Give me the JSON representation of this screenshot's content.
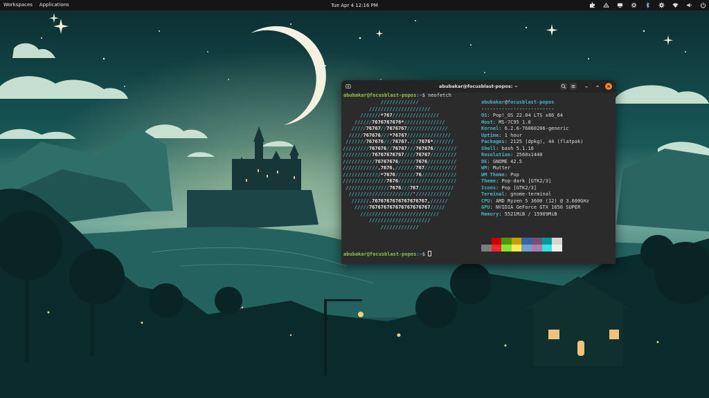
{
  "topbar": {
    "workspaces": "Workspaces",
    "applications": "Applications",
    "clock": "Tue Apr 4  12:16 PM",
    "tray": [
      "extension-icon",
      "network-icon",
      "screen-share-icon",
      "settings-indicator-icon",
      "bluetooth-icon",
      "gear-icon",
      "wifi-icon",
      "volume-icon",
      "power-icon"
    ]
  },
  "terminal": {
    "title": "abubakar@focusblast-popos: ~",
    "prompt_user": "abubakar@focusblast-popos",
    "prompt_path": ":~",
    "prompt_symbol": "$ ",
    "command": "neofetch",
    "header_user": "abubakar",
    "header_at": "@",
    "header_host": "focusblast-popos",
    "separator": "-------------------------",
    "info": [
      {
        "key": "OS",
        "value": "Pop!_OS 22.04 LTS x86_64"
      },
      {
        "key": "Host",
        "value": "MS-7C95 1.0"
      },
      {
        "key": "Kernel",
        "value": "6.2.6-76060206-generic"
      },
      {
        "key": "Uptime",
        "value": "1 hour"
      },
      {
        "key": "Packages",
        "value": "2125 (dpkg), 44 (flatpak)"
      },
      {
        "key": "Shell",
        "value": "bash 5.1.16"
      },
      {
        "key": "Resolution",
        "value": "2560x1440"
      },
      {
        "key": "DE",
        "value": "GNOME 42.5"
      },
      {
        "key": "WM",
        "value": "Mutter"
      },
      {
        "key": "WM Theme",
        "value": "Pop"
      },
      {
        "key": "Theme",
        "value": "Pop-dark [GTK2/3]"
      },
      {
        "key": "Icons",
        "value": "Pop [GTK2/3]"
      },
      {
        "key": "Terminal",
        "value": "gnome-terminal"
      },
      {
        "key": "CPU",
        "value": "AMD Ryzen 5 3600 (12) @ 3.600GHz"
      },
      {
        "key": "GPU",
        "value": "NVIDIA GeForce GTX 1650 SUPER"
      },
      {
        "key": "Memory",
        "value": "5521MiB / 15909MiB"
      }
    ],
    "palette_row1": [
      "#2b2b2b",
      "#cc0000",
      "#4e9a06",
      "#c4a000",
      "#3465a4",
      "#75507b",
      "#06989a",
      "#d3d7cf"
    ],
    "palette_row2": [
      "#7d7d7d",
      "#ef2929",
      "#8ae234",
      "#fce94f",
      "#729fcf",
      "#ad7fa8",
      "#34e2e2",
      "#eeeeec"
    ],
    "logo_lines": [
      "             /////////////",
      "         /////////////////////",
      "      ///////*767////////////////",
      "    //////7676767676*//////////////",
      "   /////76767//7676767//////////////",
      "  /////767676///*76767///////////////",
      " ///////767676///76767.///7676*///////",
      "/////////767676//76767///767676////////",
      "//////////76767676767////76767/////////",
      "///////////76767676//////7676//////////",
      "////////////,7676,///////767///////////",
      "/////////////*7676///////76////////////",
      "///////////////7676////////////////////",
      " ///////////////7676///767////////////",
      "  //////////////////////'////////////",
      "   //////.7676767676767676767,//////",
      "    /////767676767676767676767/////",
      "      ///////////////////////////",
      "         /////////////////////",
      "             /////////////"
    ]
  }
}
